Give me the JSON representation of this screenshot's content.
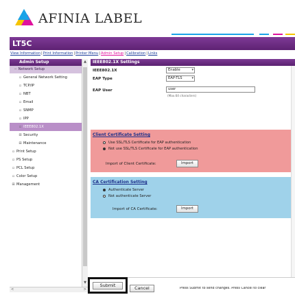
{
  "brand": {
    "name": "AFINIA LABEL"
  },
  "header": {
    "model": "LT5C",
    "dash_colors": [
      "#1aa3e8",
      "#e0119d",
      "#f5c400"
    ]
  },
  "top_links": [
    {
      "label": "View Information",
      "active": false
    },
    {
      "label": "Print Information",
      "active": false
    },
    {
      "label": "Printer Menu",
      "active": false
    },
    {
      "label": "Admin Setup",
      "active": true
    },
    {
      "label": "Calibration",
      "active": false
    },
    {
      "label": "Links",
      "active": false
    }
  ],
  "leftnav": {
    "header": "Admin Setup",
    "group": "Network Setup",
    "items": [
      {
        "label": "General Network Setting",
        "icon": "doc-icon"
      },
      {
        "label": "TCP/IP",
        "icon": "doc-icon"
      },
      {
        "label": "NBT",
        "icon": "doc-icon"
      },
      {
        "label": "Email",
        "icon": "doc-icon"
      },
      {
        "label": "SNMP",
        "icon": "doc-icon"
      },
      {
        "label": "IPP",
        "icon": "doc-icon"
      },
      {
        "label": "IEEE802.1X",
        "icon": "doc-icon",
        "selected": true
      },
      {
        "label": "Security",
        "icon": "plus-icon"
      },
      {
        "label": "Maintenance",
        "icon": "plus-icon"
      }
    ],
    "other": [
      {
        "label": "Print Setup",
        "icon": "doc-icon"
      },
      {
        "label": "PS Setup",
        "icon": "doc-icon"
      },
      {
        "label": "PCL Setup",
        "icon": "doc-icon"
      },
      {
        "label": "Color Setup",
        "icon": "doc-icon"
      },
      {
        "label": "Management",
        "icon": "plus-icon"
      }
    ]
  },
  "main": {
    "title": "IEEE802.1X Settings",
    "ieee_label": "IEEE802.1X",
    "ieee_value": "Enable",
    "eap_type_label": "EAP Type",
    "eap_type_value": "EAP-TLS",
    "eap_user_label": "EAP User",
    "eap_user_value": "user",
    "eap_user_hint": "(Max.64 characters)",
    "client_cert": {
      "title": "Client Certificate Setting",
      "option1": "Use SSL/TLS Certificate for EAP authentication",
      "option2": "Not use SSL/TLS Certificate for EAP authentication",
      "selected": 2,
      "import_label": "Import of Client Certificate:",
      "import_button": "Import",
      "color": "#f09a9a"
    },
    "ca_cert": {
      "title": "CA Certification Setting",
      "option1": "Authenticate Server",
      "option2": "Not authenticate Server",
      "selected": 1,
      "import_label": "Import of CA Certificate:",
      "import_button": "Import",
      "color": "#9fd2ea"
    }
  },
  "bottom": {
    "submit": "Submit",
    "cancel": "Cancel",
    "message": "Press Submit to send changes. Press Cancel to clear"
  }
}
